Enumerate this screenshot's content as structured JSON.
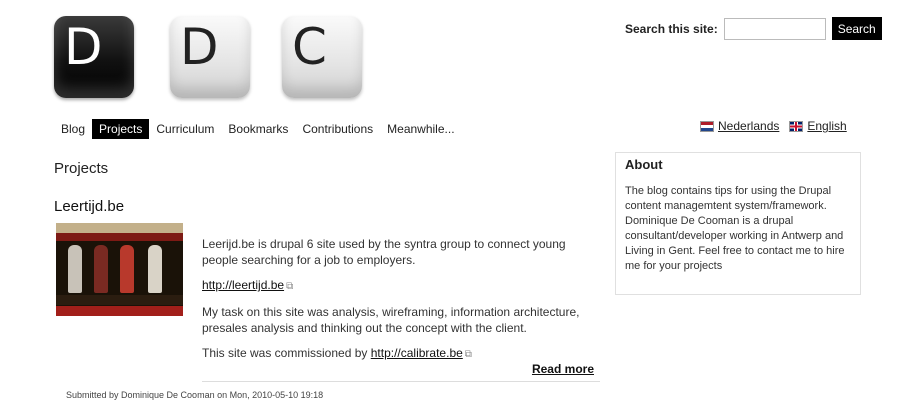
{
  "logo": {
    "keys": [
      "D",
      "D",
      "C"
    ]
  },
  "search": {
    "label": "Search this site:",
    "value": "",
    "button_label": "Search"
  },
  "nav": {
    "items": [
      {
        "label": "Blog"
      },
      {
        "label": "Projects",
        "active": true
      },
      {
        "label": "Curriculum"
      },
      {
        "label": "Bookmarks"
      },
      {
        "label": "Contributions"
      },
      {
        "label": "Meanwhile..."
      }
    ]
  },
  "languages": [
    {
      "label": "Nederlands",
      "flag": "nl-flag-icon"
    },
    {
      "label": "English",
      "flag": "uk-flag-icon"
    }
  ],
  "main": {
    "page_title": "Projects",
    "node": {
      "title": "Leertijd.be",
      "paragraph1": "Leerijd.be is drupal 6 site used by the syntra group to connect young people searching for a job to employers.",
      "link1": "http://leertijd.be",
      "paragraph2": "My task on this site was analysis, wireframing, information architecture, presales analysis and thinking out the concept with the client.",
      "commissioned_prefix": "This site was commissioned by ",
      "link2": "http://calibrate.be",
      "read_more": "Read more",
      "submitted": "Submitted by Dominique De Cooman on Mon, 2010-05-10 19:18"
    }
  },
  "sidebar": {
    "about": {
      "title": "About",
      "text": "The blog contains tips for using the Drupal content managemtent system/framework. Dominique De Cooman is a drupal consultant/developer working in Antwerp and Living in Gent. Feel free to contact me to hire me for your projects"
    }
  },
  "colors": {
    "accent": "#000000",
    "text": "#222222",
    "border": "#e0e0e0"
  }
}
